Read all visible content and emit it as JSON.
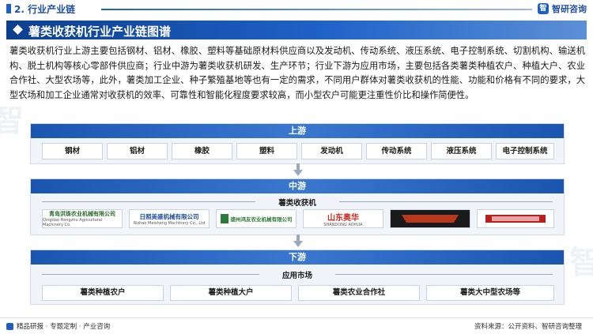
{
  "header": {
    "section_title": "2. 行业产业链",
    "logo_text": "智研咨询"
  },
  "banner": {
    "title": "薯类收获机行业产业链图谱"
  },
  "intro": "薯类收获机行业上游主要包括钢材、铝材、橡胶、塑料等基础原材料供应商以及发动机、传动系统、液压系统、电子控制系统、切割机构、输送机构、脱土机构等核心零部件供应商；行业中游为薯类收获机研发、生产环节；行业下游为应用市场，主要包括各类薯类种植农户、种植大户、农业合作社、大型农场等，此外，薯类加工企业、种子繁殖基地等也有一定的需求，不同用户群体对薯类收获机的性能、功能和价格有不同的要求，大型农场和加工企业通常对收获机的效率、可靠性和智能化程度要求较高，而小型农户可能更注重性价比和操作简便性。",
  "upstream": {
    "title": "上游",
    "items": [
      "钢材",
      "铝材",
      "橡胶",
      "塑料",
      "发动机",
      "传动系统",
      "液压系统",
      "电子控制系统"
    ]
  },
  "midstream": {
    "title": "中游",
    "subtitle": "薯类收获机",
    "brands": [
      {
        "text": "青岛洪珠农业机械有限公司",
        "sub": "Qingdao Hongzhu Agricultural Machinery Co.",
        "color": "#2a6b2a"
      },
      {
        "text": "日照美盛机械有限公司",
        "sub": "Rizhao Meisheng Machinery Co., Ltd",
        "color": "#1f4fa0"
      },
      {
        "text": "德州鸿友农业机械有限公司",
        "sub": "",
        "color": "#2a7a3a"
      },
      {
        "text": "山东奥华",
        "sub": "SHANDONG AOHUA",
        "color": "#c8281e"
      },
      {
        "text": "",
        "sub": "",
        "color": "#b83a1e"
      },
      {
        "text": "",
        "sub": "",
        "color": "#b8201e"
      }
    ]
  },
  "downstream": {
    "title": "下游",
    "subtitle": "应用市场",
    "items": [
      "薯类种植农户",
      "薯类种植大户",
      "薯类农业合作社",
      "薯类大中型农场等"
    ]
  },
  "footer": {
    "left": "精品研报 · 专题定制 · 产业咨询",
    "right": "资料来源：公开资料、智研咨询整理"
  }
}
